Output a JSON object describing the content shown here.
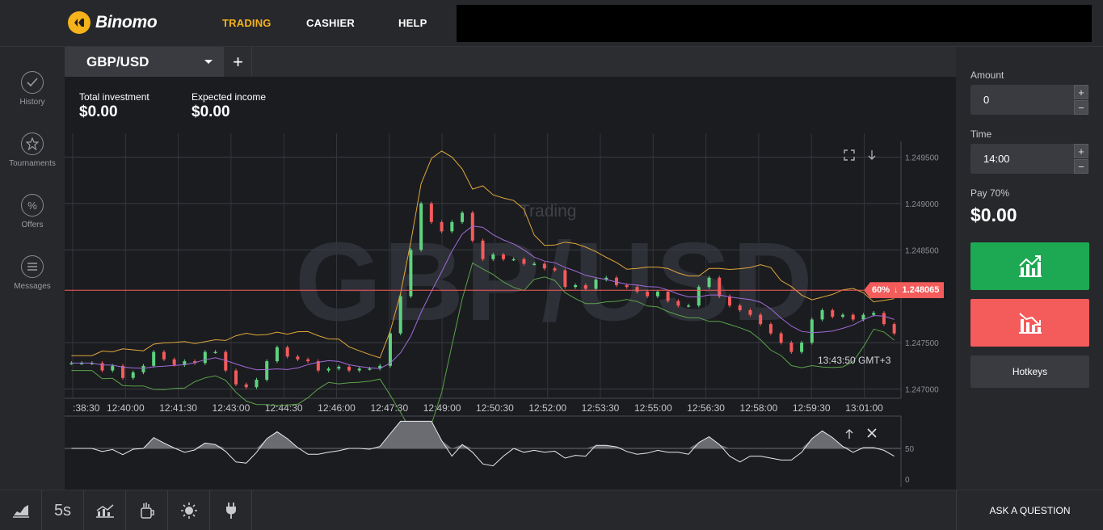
{
  "app": {
    "brand": "Binomo",
    "colors": {
      "accent": "#f5b21b",
      "call_green": "#1da853",
      "put_red": "#f45b5b",
      "bg": "#1e1f23"
    }
  },
  "topnav": {
    "items": [
      {
        "label": "TRADING",
        "active": true
      },
      {
        "label": "CASHIER",
        "active": false
      },
      {
        "label": "HELP",
        "active": false
      }
    ]
  },
  "sidebar": {
    "items": [
      {
        "label": "History",
        "icon": "check-circle-icon"
      },
      {
        "label": "Tournaments",
        "icon": "trophy-icon"
      },
      {
        "label": "Offers",
        "icon": "percent-icon"
      },
      {
        "label": "Messages",
        "icon": "messages-icon"
      }
    ]
  },
  "asset_tab": {
    "label": "GBP/USD",
    "add_label": "+"
  },
  "summary": {
    "total_investment_label": "Total investment",
    "total_investment_value": "$0.00",
    "expected_income_label": "Expected income",
    "expected_income_value": "$0.00"
  },
  "chart": {
    "watermark": "GBP/USD",
    "status_watermark": "Trading",
    "current_price_tag": {
      "payout": "60%",
      "direction": "↓",
      "price": "1.248065"
    },
    "time_readout": "13:43:50 GMT+3"
  },
  "chart_data": {
    "type": "line",
    "price_axis": {
      "ticks": [
        "1.249500",
        "1.249000",
        "1.248500",
        "1.247500",
        "1.247000"
      ],
      "ylim": [
        1.2469,
        1.2496
      ]
    },
    "time_axis": {
      "ticks": [
        ":38:30",
        "12:40:00",
        "12:41:30",
        "12:43:00",
        "12:44:30",
        "12:46:00",
        "12:47:30",
        "12:49:00",
        "12:50:30",
        "12:52:00",
        "12:53:30",
        "12:55:00",
        "12:56:30",
        "12:58:00",
        "12:59:30",
        "13:01:00"
      ]
    },
    "current_price": 1.248065,
    "close_series": [
      1.24728,
      1.24728,
      1.24728,
      1.2472,
      1.24725,
      1.24712,
      1.24718,
      1.24725,
      1.2474,
      1.24732,
      1.24726,
      1.2473,
      1.24728,
      1.2474,
      1.2474,
      1.2472,
      1.24705,
      1.24702,
      1.2471,
      1.2473,
      1.24745,
      1.24735,
      1.24732,
      1.2473,
      1.2472,
      1.24722,
      1.24724,
      1.2472,
      1.24722,
      1.24722,
      1.24725,
      1.2476,
      1.248,
      1.2485,
      1.249,
      1.2488,
      1.2487,
      1.2488,
      1.2489,
      1.2486,
      1.2484,
      1.24845,
      1.2484,
      1.2484,
      1.24835,
      1.24835,
      1.2483,
      1.24828,
      1.2481,
      1.24812,
      1.24808,
      1.24818,
      1.2482,
      1.24812,
      1.2481,
      1.24805,
      1.248,
      1.24805,
      1.24795,
      1.2479,
      1.2479,
      1.2481,
      1.2482,
      1.248,
      1.2479,
      1.24785,
      1.2478,
      1.2477,
      1.2476,
      1.2475,
      1.2474,
      1.2475,
      1.24775,
      1.24785,
      1.24778,
      1.2478,
      1.24775,
      1.2478,
      1.24782,
      1.2477,
      1.2476
    ],
    "oscillator": {
      "axis_ticks": [
        "50",
        "0"
      ],
      "level": 50
    }
  },
  "right_panel": {
    "amount_label": "Amount",
    "amount_value": "0",
    "time_label": "Time",
    "time_value": "14:00",
    "payout_label": "Pay 70%",
    "payout_value": "$0.00",
    "hotkeys_label": "Hotkeys",
    "stepper_plus": "+",
    "stepper_minus": "−"
  },
  "bottom_tools": {
    "items": [
      {
        "icon": "chart-type-icon"
      },
      {
        "label": "5s",
        "icon": "timeframe-icon"
      },
      {
        "icon": "indicators-icon"
      },
      {
        "icon": "drawing-tools-icon"
      },
      {
        "icon": "theme-icon"
      },
      {
        "icon": "plugin-icon"
      }
    ],
    "ask_question": "ASK A QUESTION"
  }
}
